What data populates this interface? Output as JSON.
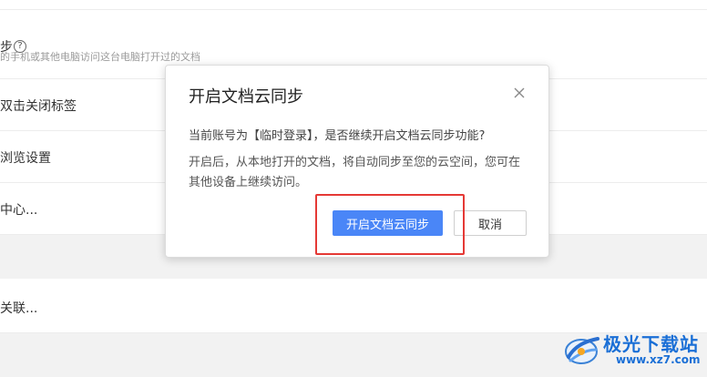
{
  "settings": {
    "rows": [
      {
        "title": "步",
        "subtitle": "的手机或其他电脑访问这台电脑打开过的文档"
      },
      {
        "title": "双击关闭标签"
      },
      {
        "title": "浏览设置"
      },
      {
        "title": "中心..."
      },
      {
        "title": "关联..."
      }
    ],
    "help_symbol": "?"
  },
  "dialog": {
    "title": "开启文档云同步",
    "message_account": "当前账号为【临时登录】，是否继续开启文档云同步功能?",
    "message_detail": "开启后，从本地打开的文档，将自动同步至您的云空间，您可在其他设备上继续访问。",
    "confirm_label": "开启文档云同步",
    "cancel_label": "取消",
    "accent_color": "#4a86f7"
  },
  "annotation": {
    "highlight_color": "#e53935"
  },
  "watermark": {
    "brand": "极光下载站",
    "url": "www.xz7.com"
  }
}
